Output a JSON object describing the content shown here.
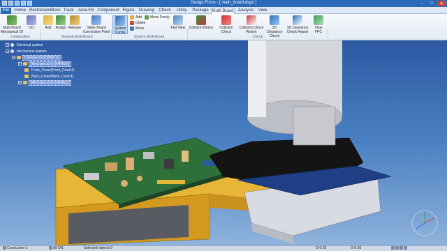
{
  "window": {
    "title": "Design Force - [ main_board.dsgn ]"
  },
  "tabs": [
    "File",
    "Home",
    "Restriction/Block",
    "Track",
    "Area Fill",
    "Component",
    "Figure",
    "Drawing",
    "Check",
    "Utility",
    "Package",
    "Multi-Board",
    "Analysis",
    "View"
  ],
  "ribbon": {
    "groups": [
      "Composition",
      "Stacked Multi-Board",
      "System Multi-Board",
      "Check"
    ],
    "buttons": {
      "mb_oi": "Multi-Board Mechanical OI",
      "oi": "OO",
      "add": "Add",
      "assign": "Assign",
      "release": "Release",
      "slider": "Slider Board Connection Point",
      "system_config": "System Config",
      "sys_add": "Add",
      "sys_delete": "Delete",
      "sys_move": "Move",
      "move_freely": "Move Freely",
      "flat_view": "Flat View",
      "collision_notice": "Collision Notice",
      "collision_check": "Collision Check",
      "collision_check_report": "Collision Check Report",
      "clearance_check_3d": "3D Clearance Check",
      "clearance_check_report_3d": "3D Clearance Check Report",
      "view_fpc": "View FPC"
    }
  },
  "tree": {
    "items": [
      {
        "label": "Electrical system",
        "level": 0,
        "selected": false
      },
      {
        "label": "Mechanical system",
        "level": 0,
        "selected": false
      },
      {
        "label": "[Standard(x)] [MNK(x)]",
        "level": 1,
        "selected": true
      },
      {
        "label": "[Mechanical(x)] [MNK(x)]",
        "level": 2,
        "selected": true
      },
      {
        "label": "Front_Cover(Front_Cover1)",
        "level": 3,
        "selected": false
      },
      {
        "label": "Back_Cover(Back_Cover1)",
        "level": 3,
        "selected": false
      },
      {
        "label": "[Mechanical(x)] [MNK(x)]",
        "level": 2,
        "selected": true
      }
    ]
  },
  "status": {
    "layer": "Conduction-1",
    "all_on": "All ON",
    "selected": "Selected objects 0",
    "g1": "G-0.02",
    "g2": "G-0.50"
  },
  "colors": {
    "title_bar": "#2a6ab8",
    "viewport_top": "#2d5aa3",
    "viewport_bottom": "#8fb3dc",
    "pcb_green": "#2f6f3a",
    "housing_yellow": "#e8b637",
    "cover_light": "#d9dbe2"
  }
}
